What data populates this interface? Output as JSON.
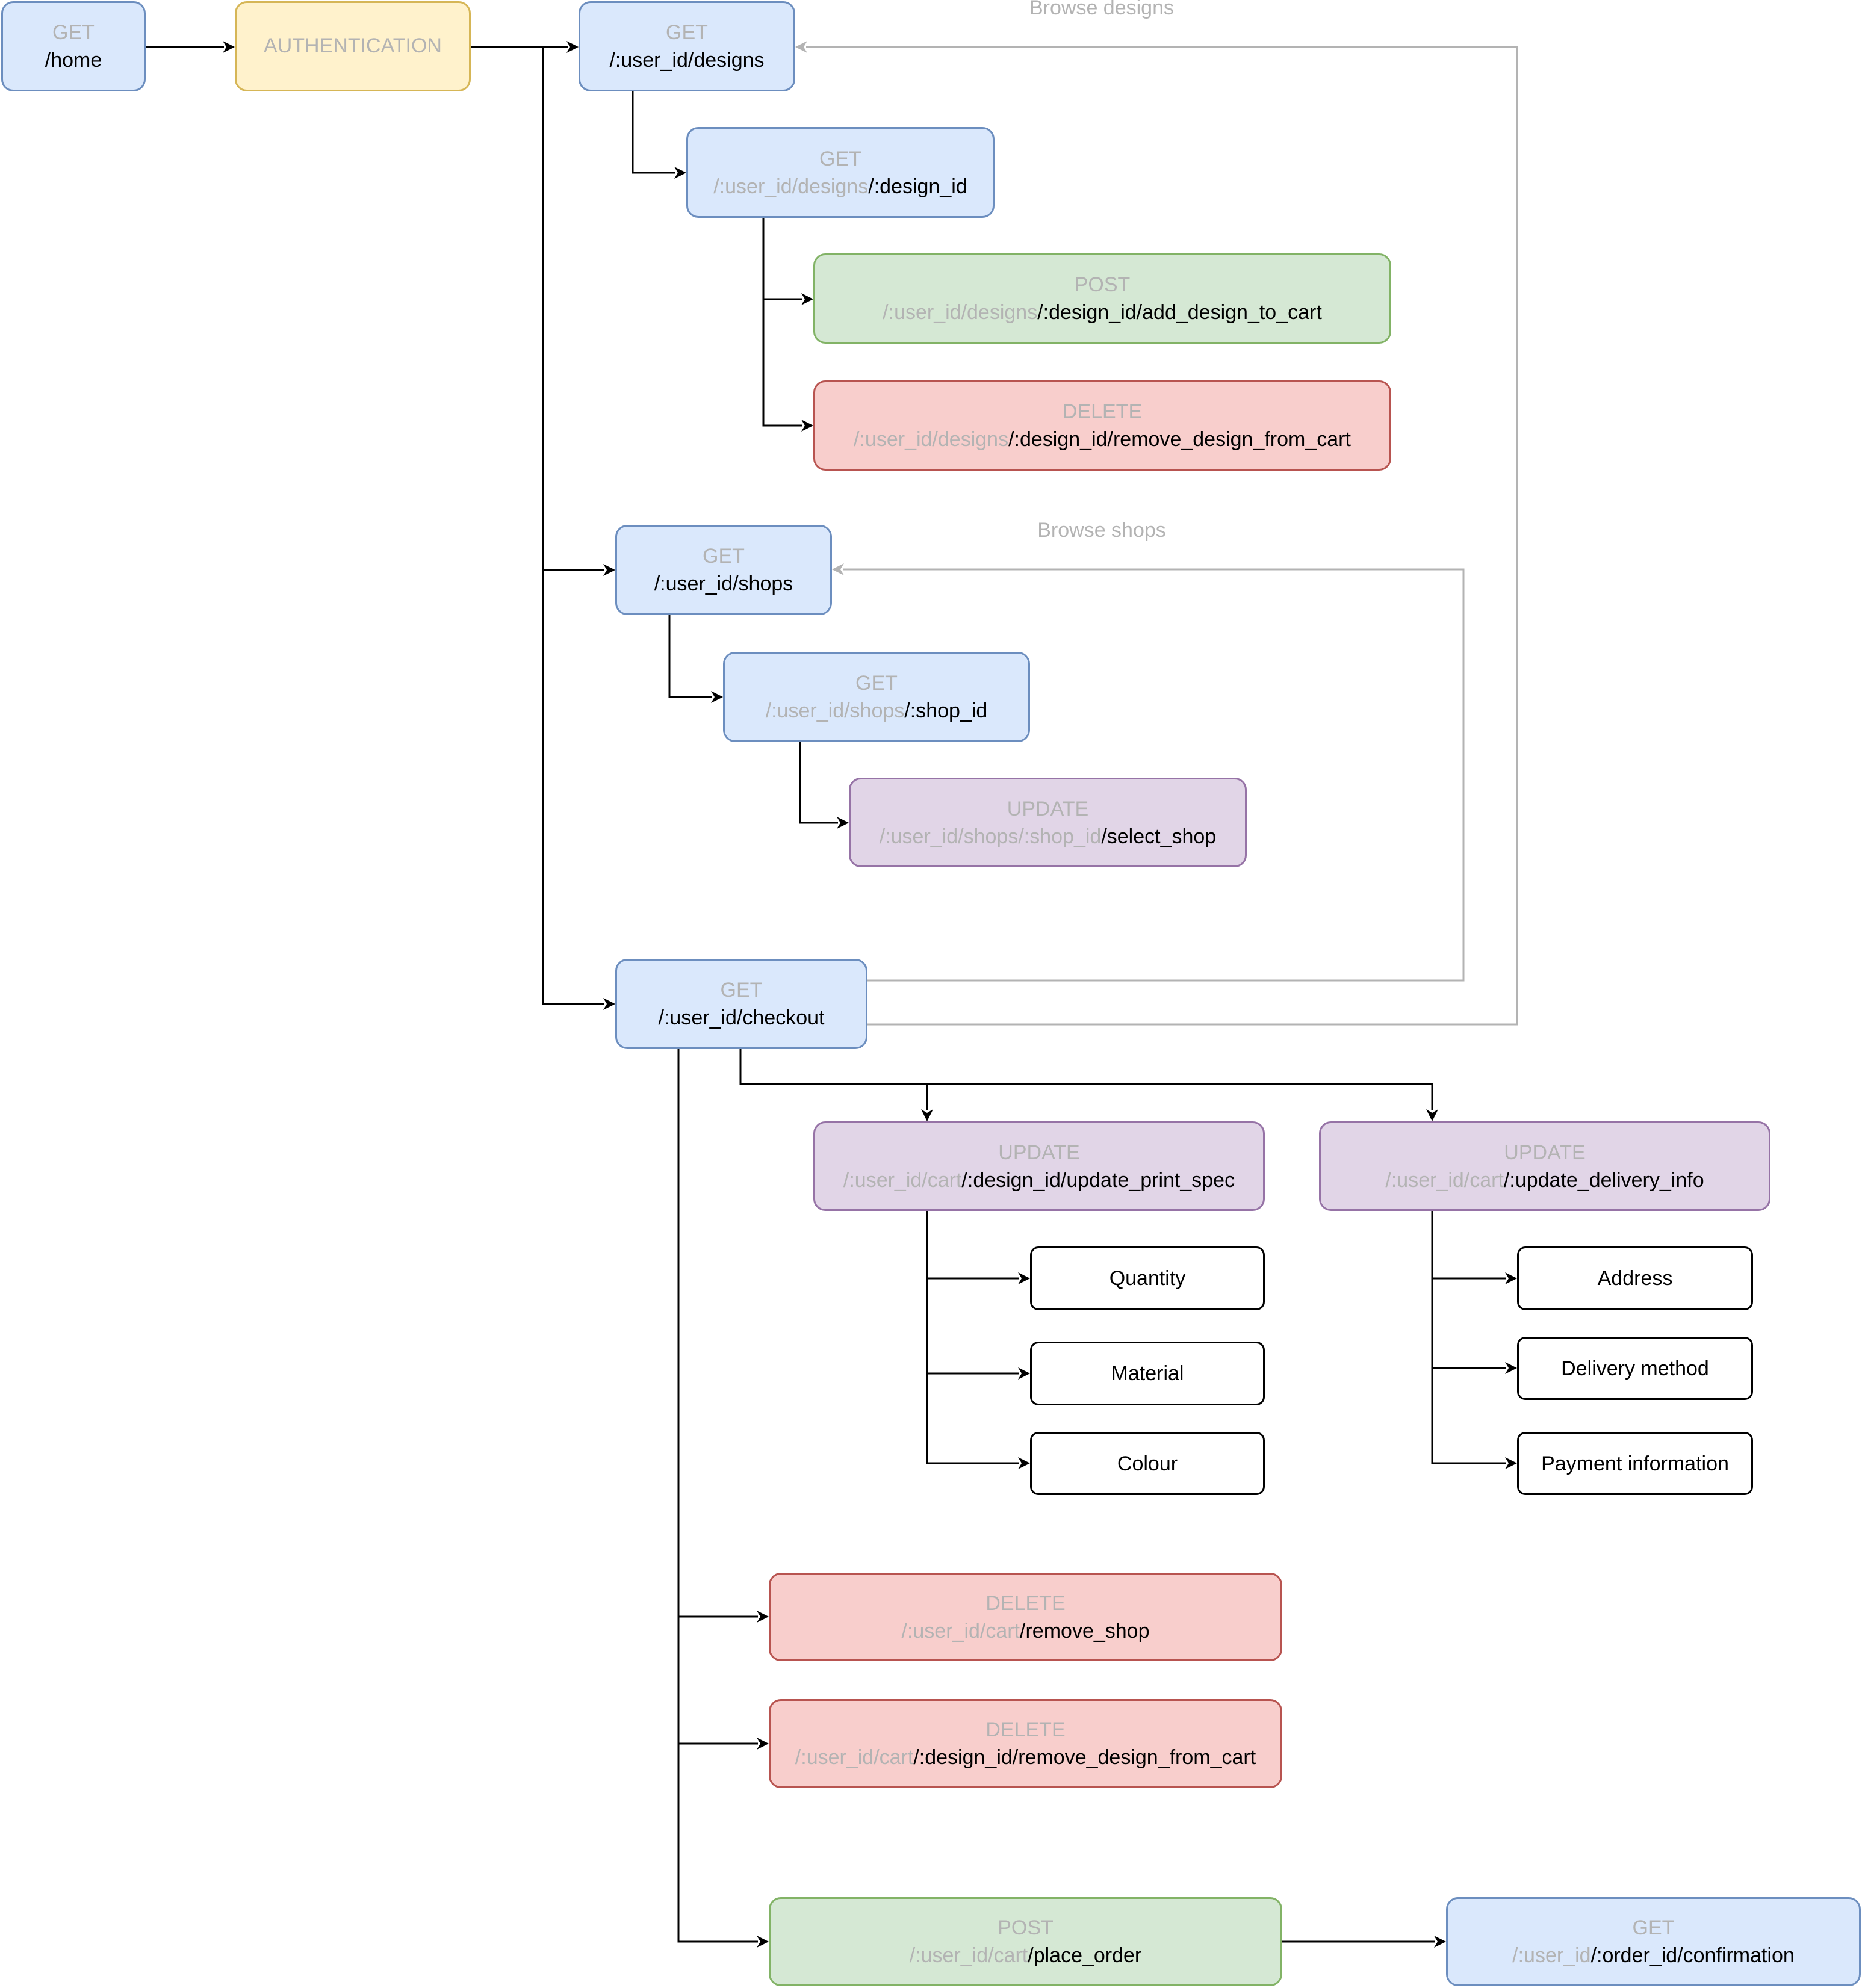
{
  "diagram": {
    "colors": {
      "get": "#dae8fc",
      "auth": "#fff2cc",
      "post": "#d5e8d4",
      "delete": "#f8cecc",
      "update": "#e1d5e7",
      "muted_text": "#b3b3b3",
      "loop_line": "#b3b3b3"
    },
    "loop_labels": {
      "browse_designs": "Browse designs",
      "browse_shops": "Browse shops"
    },
    "nodes": {
      "home": {
        "method": "GET",
        "prefix": "",
        "path": "/home"
      },
      "auth": {
        "label": "AUTHENTICATION"
      },
      "designs": {
        "method": "GET",
        "prefix": "",
        "path": "/:user_id/designs"
      },
      "design_id": {
        "method": "GET",
        "prefix": "/:user_id/designs",
        "path": "/:design_id"
      },
      "add_design_to_cart": {
        "method": "POST",
        "prefix": "/:user_id/designs",
        "path": "/:design_id/add_design_to_cart"
      },
      "remove_design_from_cart_designs": {
        "method": "DELETE",
        "prefix": "/:user_id/designs",
        "path": "/:design_id/remove_design_from_cart"
      },
      "shops": {
        "method": "GET",
        "prefix": "",
        "path": "/:user_id/shops"
      },
      "shop_id": {
        "method": "GET",
        "prefix": "/:user_id/shops",
        "path": "/:shop_id"
      },
      "select_shop": {
        "method": "UPDATE",
        "prefix": "/:user_id/shops/:shop_id",
        "path": "/select_shop"
      },
      "checkout": {
        "method": "GET",
        "prefix": "",
        "path": "/:user_id/checkout"
      },
      "update_print_spec": {
        "method": "UPDATE",
        "prefix": "/:user_id/cart",
        "path": "/:design_id/update_print_spec"
      },
      "update_delivery_info": {
        "method": "UPDATE",
        "prefix": "/:user_id/cart",
        "path": "/:update_delivery_info"
      },
      "remove_shop": {
        "method": "DELETE",
        "prefix": "/:user_id/cart",
        "path": "/remove_shop"
      },
      "remove_design_from_cart": {
        "method": "DELETE",
        "prefix": "/:user_id/cart",
        "path": "/:design_id/remove_design_from_cart"
      },
      "place_order": {
        "method": "POST",
        "prefix": "/:user_id/cart",
        "path": "/place_order"
      },
      "confirmation": {
        "method": "GET",
        "prefix": "/:user_id",
        "path": "/:order_id/confirmation"
      }
    },
    "print_spec_fields": [
      "Quantity",
      "Material",
      "Colour"
    ],
    "delivery_fields": [
      "Address",
      "Delivery method",
      "Payment information"
    ]
  }
}
